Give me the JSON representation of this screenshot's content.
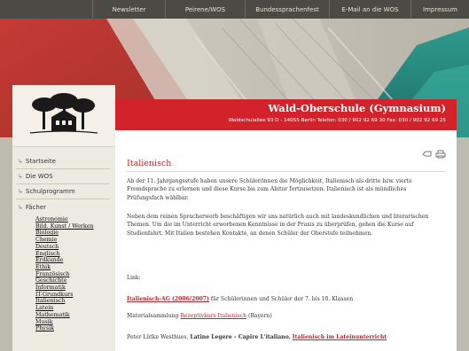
{
  "topnav": {
    "items": [
      "Newsletter",
      "Peirene/WOS",
      "Bundessprachenfest",
      "E-Mail an die WOS",
      "Impressum"
    ]
  },
  "school": {
    "title": "Wald-Oberschule (Gymnasium)",
    "address": "Waldschulallee 93   D - 14055 Berlin   Telefon: 030 / 902 92 69 30   Fax: 030 / 902 92 69 25"
  },
  "sidebar": {
    "links": [
      "Startseite",
      "Die WOS",
      "Schulprogramm",
      "Fächer"
    ],
    "subjects": [
      "Astronomie",
      "Bild. Kunst / Werken",
      "Biologie",
      "Chemie",
      "Deutsch",
      "Englisch",
      "Erdkunde",
      "Ethik",
      "Französisch",
      "Geschichte",
      "Informatik",
      "IT-Grundkurs",
      "Italienisch",
      "Latein",
      "Mathematik",
      "Musik",
      "Physik"
    ]
  },
  "content": {
    "heading": "Italienisch",
    "para1": "Ab der 11. Jahrgangsstufe haben unsere Schüler/innen die Möglichkeit, Italienisch als dritte bzw. vierte Fremdsprache zu erlernen und diese Kurse bis zum Abitur fortzusetzen. Italienisch ist als mündliches Prüfungsfach wählbar.",
    "para2": "Neben dem reinen Spracherwerb beschäftigen wir uns natürlich auch mit landeskundlichen und literarischen Themen. Um die im Unterricht erworbenen Kenntnisse in der Praxis zu überprüfen, gehen die Kurse auf Studienfahrt. Mit Italien bestehen Kontakte, an denen Schüler der Oberstufe teilnehmen.",
    "links_label": "Link:",
    "ag_link": "Italienisch-AG (2006/2007)",
    "ag_text": " für Schülerinnen und Schüler der 7. bis 10. Klassen",
    "materials_prefix": "Materialsammlung ",
    "materials_link": "Rezeptivkurs Italienisch",
    "materials_suffix": " (Bayern)",
    "latin_author": "Peter Lütke Westhues, ",
    "latin_title": "Latine Legere – Capire L'italiano.",
    "latin_link": "Italienisch im Lateinunterricht"
  },
  "colors": {
    "accent_red": "#d2232a",
    "nav_bg": "#4c4a44",
    "link_red": "#b3262b"
  }
}
